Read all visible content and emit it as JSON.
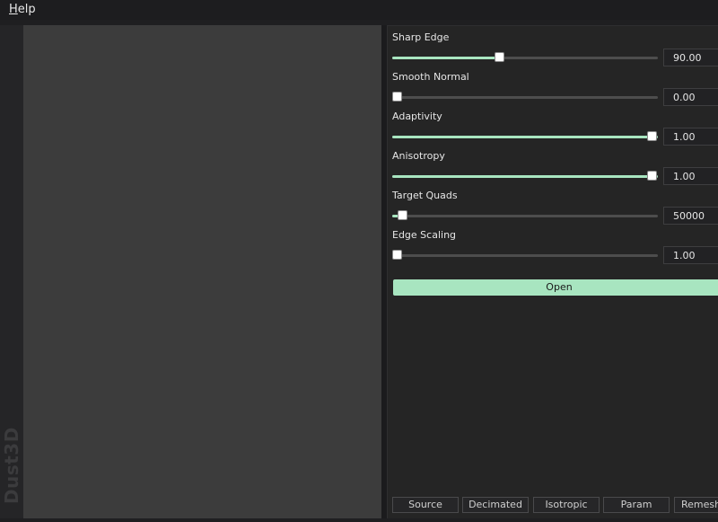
{
  "menu": {
    "help_mnemonic": "H",
    "help_rest": "elp"
  },
  "brand": {
    "text": "Dust3D"
  },
  "params": [
    {
      "label": "Sharp Edge",
      "value": "90.00",
      "fraction": 0.405
    },
    {
      "label": "Smooth Normal",
      "value": "0.00",
      "fraction": 0.0
    },
    {
      "label": "Adaptivity",
      "value": "1.00",
      "fraction": 1.0
    },
    {
      "label": "Anisotropy",
      "value": "1.00",
      "fraction": 1.0
    },
    {
      "label": "Target Quads",
      "value": "50000",
      "fraction": 0.04
    },
    {
      "label": "Edge Scaling",
      "value": "1.00",
      "fraction": 0.0
    }
  ],
  "open_button": {
    "label": "Open"
  },
  "tabs": [
    {
      "label": "Source"
    },
    {
      "label": "Decimated"
    },
    {
      "label": "Isotropic"
    },
    {
      "label": "Param"
    },
    {
      "label": "Remesh"
    }
  ],
  "colors": {
    "accent": "#a8e5c0",
    "viewport": "#3c3c3c",
    "panel": "#252525",
    "background": "#1f1f21"
  }
}
